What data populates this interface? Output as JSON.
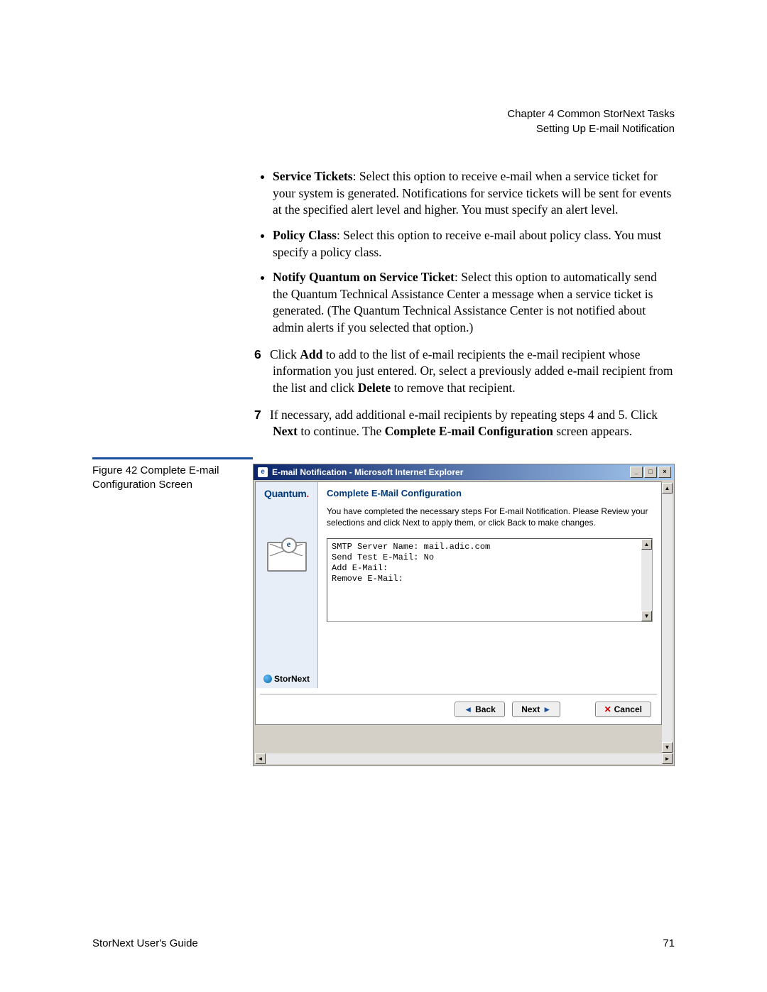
{
  "header": {
    "line1": "Chapter 4  Common StorNext Tasks",
    "line2": "Setting Up E-mail Notification"
  },
  "body": {
    "bullets": [
      {
        "label": "Service Tickets",
        "text": ": Select this option to receive e-mail when a service ticket for your system is generated. Notifications for service tickets will be sent for events at the specified alert level and higher. You must specify an alert level."
      },
      {
        "label": "Policy Class",
        "text": ": Select this option to receive e-mail about policy class. You must specify a policy class."
      },
      {
        "label": "Notify Quantum on Service Ticket",
        "text": ": Select this option to automatically send the Quantum Technical Assistance Center a message when a service ticket is generated. (The Quantum Technical Assistance Center is not notified about admin alerts if you selected that option.)"
      }
    ],
    "step6": {
      "num": "6",
      "pre": "Click ",
      "addWord": "Add",
      "mid": " to add to the list of e-mail recipients the e-mail recipient whose information you just entered. Or, select a previously added e-mail recipient from the list and click ",
      "deleteWord": "Delete",
      "post": " to remove that recipient."
    },
    "step7": {
      "num": "7",
      "pre": "If necessary, add additional e-mail recipients by repeating steps 4 and 5. Click ",
      "nextWord": "Next",
      "mid": " to continue. The ",
      "screenWord": "Complete E-mail Configuration",
      "post": " screen appears."
    }
  },
  "figure": {
    "caption": "Figure 42  Complete E-mail Configuration Screen"
  },
  "window": {
    "title": "E-mail Notification - Microsoft Internet Explorer",
    "sidebar": {
      "brand": "Quantum",
      "product": "StorNext"
    },
    "main": {
      "title": "Complete E-Mail Configuration",
      "desc": "You have completed the necessary steps For E-mail Notification. Please Review your selections and click Next to apply them, or click Back to make changes.",
      "configLines": "SMTP Server Name: mail.adic.com\nSend Test E-Mail: No\nAdd E-Mail:\nRemove E-Mail:"
    },
    "buttons": {
      "back": "Back",
      "next": "Next",
      "cancel": "Cancel"
    }
  },
  "footer": {
    "left": "StorNext User's Guide",
    "right": "71"
  }
}
